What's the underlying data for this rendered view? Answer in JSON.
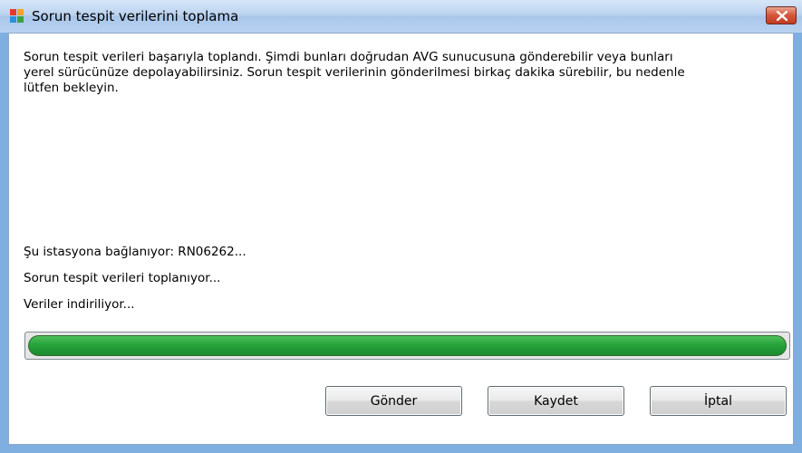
{
  "window": {
    "title": "Sorun tespit verilerini toplama",
    "close_icon": "close-icon",
    "app_icon": "avg-logo-icon"
  },
  "dialog": {
    "description": "Sorun tespit verileri başarıyla toplandı. Şimdi bunları doğrudan AVG sunucusuna gönderebilir veya bunları\nyerel sürücünüze depolayabilirsiniz. Sorun tespit verilerinin gönderilmesi birkaç dakika sürebilir, bu nedenle\nlütfen bekleyin.",
    "status_lines": [
      "Şu istasyona bağlanıyor: RN06262...",
      "Sorun tespit verileri toplanıyor...",
      "Veriler indiriliyor..."
    ],
    "progress": 1.0,
    "progress_color": "#27a33c"
  },
  "buttons": {
    "send_label": "Gönder",
    "save_label": "Kaydet",
    "cancel_label": "İptal"
  }
}
